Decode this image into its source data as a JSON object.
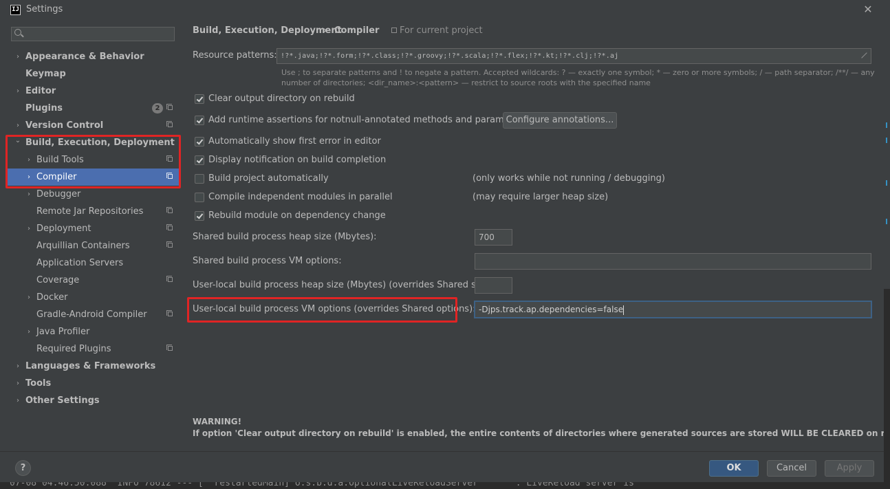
{
  "window": {
    "title": "Settings",
    "app_icon_text": "IJ"
  },
  "sidebar": {
    "search_placeholder": "",
    "items": [
      {
        "label": "Appearance & Behavior",
        "chevron": "›"
      },
      {
        "label": "Keymap"
      },
      {
        "label": "Editor",
        "chevron": "›"
      },
      {
        "label": "Plugins",
        "badge": "2"
      },
      {
        "label": "Version Control",
        "chevron": "›"
      },
      {
        "label": "Build, Execution, Deployment",
        "chevron": "⌄"
      },
      {
        "label": "Build Tools",
        "chevron": "›"
      },
      {
        "label": "Compiler",
        "chevron": "›"
      },
      {
        "label": "Debugger",
        "chevron": "›"
      },
      {
        "label": "Remote Jar Repositories"
      },
      {
        "label": "Deployment",
        "chevron": "›"
      },
      {
        "label": "Arquillian Containers"
      },
      {
        "label": "Application Servers"
      },
      {
        "label": "Coverage"
      },
      {
        "label": "Docker",
        "chevron": "›"
      },
      {
        "label": "Gradle-Android Compiler"
      },
      {
        "label": "Java Profiler",
        "chevron": "›"
      },
      {
        "label": "Required Plugins"
      },
      {
        "label": "Languages & Frameworks",
        "chevron": "›"
      },
      {
        "label": "Tools",
        "chevron": "›"
      },
      {
        "label": "Other Settings",
        "chevron": "›"
      }
    ]
  },
  "main": {
    "breadcrumb": {
      "parent": "Build, Execution, Deployment",
      "separator": "›",
      "current": "Compiler"
    },
    "for_project": "For current project",
    "resource_patterns": {
      "label": "Resource patterns:",
      "value": "!?*.java;!?*.form;!?*.class;!?*.groovy;!?*.scala;!?*.flex;!?*.kt;!?*.clj;!?*.aj",
      "help": "Use ; to separate patterns and ! to negate a pattern. Accepted wildcards: ? — exactly one symbol; * — zero or more symbols; / — path separator; /**/ — any number of directories; <dir_name>:<pattern> — restrict to source roots with the specified name"
    },
    "checkboxes": [
      {
        "label": "Clear output directory on rebuild",
        "checked": "true"
      },
      {
        "label": "Add runtime assertions for notnull-annotated methods and parameters",
        "checked": "true"
      },
      {
        "label": "Automatically show first error in editor",
        "checked": "true"
      },
      {
        "label": "Display notification on build completion",
        "checked": "true"
      },
      {
        "label": "Build project automatically",
        "checked": "false",
        "hint": "(only works while not running / debugging)"
      },
      {
        "label": "Compile independent modules in parallel",
        "checked": "false",
        "hint": "(may require larger heap size)"
      },
      {
        "label": "Rebuild module on dependency change",
        "checked": "true"
      }
    ],
    "configure_annotations_label": "Configure annotations...",
    "shared_heap": {
      "label": "Shared build process heap size (Mbytes):",
      "value": "700"
    },
    "shared_vm": {
      "label": "Shared build process VM options:",
      "value": ""
    },
    "user_heap": {
      "label": "User-local build process heap size (Mbytes) (overrides Shared size):",
      "value": ""
    },
    "user_vm": {
      "label": "User-local build process VM options (overrides Shared options):",
      "value": "-Djps.track.ap.dependencies=false"
    },
    "warning_title": "WARNING!",
    "warning_text": "If option 'Clear output directory on rebuild' is enabled, the entire contents of directories where generated sources are stored WILL BE CLEARED on rebuild."
  },
  "footer": {
    "help_label": "?",
    "ok_label": "OK",
    "cancel_label": "Cancel",
    "apply_label": "Apply"
  },
  "background": {
    "bottom_text": "07-08 04:46:50.088  INFO 78612 --- [  restartedMain] o.s.b.d.a.OptionalLiveReloadServer       : LiveReload server is"
  },
  "colors": {
    "selection": "#4b6eaf",
    "highlight_box": "#e02424",
    "ok_button": "#365880"
  }
}
